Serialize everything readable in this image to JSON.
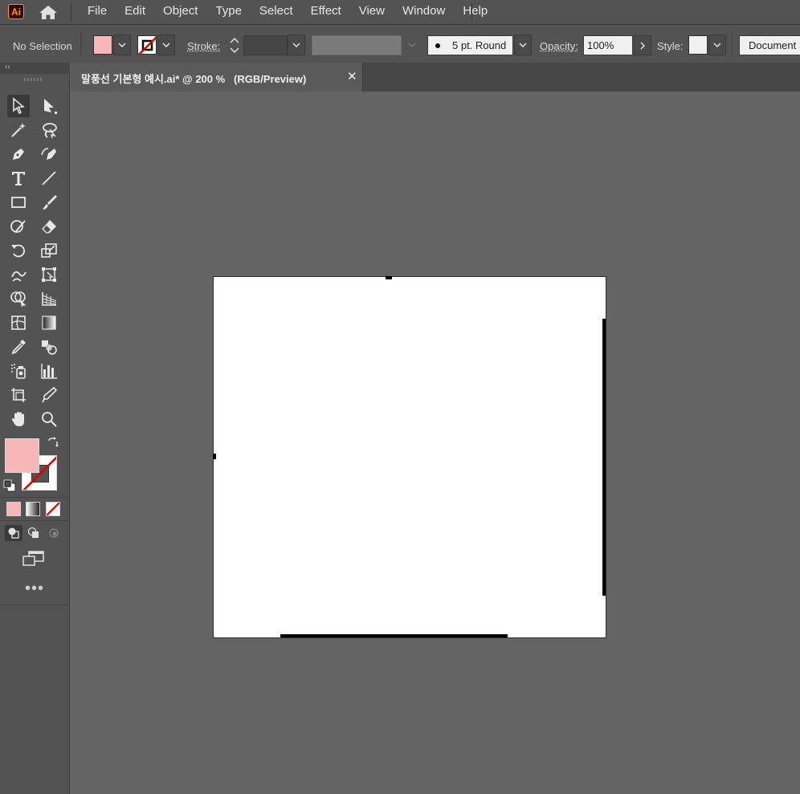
{
  "app": {
    "logo_text": "Ai",
    "brand_color": "#ff9a00"
  },
  "menu": {
    "items": [
      "File",
      "Edit",
      "Object",
      "Type",
      "Select",
      "Effect",
      "View",
      "Window",
      "Help"
    ]
  },
  "controlbar": {
    "selection_status": "No Selection",
    "fill_color": "#f7b6b8",
    "stroke_color": "none",
    "stroke_label": "Stroke:",
    "stroke_weight": "",
    "brush_label": "5 pt. Round",
    "opacity_label": "Opacity:",
    "opacity_value": "100%",
    "style_label": "Style:",
    "document_setup_label": "Document Setup"
  },
  "document_tab": {
    "title": "말풍선 기본형 예시.ai* @ 200 %   (RGB/Preview)",
    "close_symbol": "✕"
  },
  "toolbar": {
    "collapse_symbol": "‹‹",
    "more_tools_symbol": "•••",
    "tools": [
      "selection-tool",
      "direct-selection-tool",
      "magic-wand-tool",
      "lasso-tool",
      "pen-tool",
      "curvature-tool",
      "type-tool",
      "line-segment-tool",
      "rectangle-tool",
      "paintbrush-tool",
      "shaper-tool",
      "eraser-tool",
      "rotate-tool",
      "scale-tool",
      "warp-tool",
      "free-transform-tool",
      "shape-builder-tool",
      "perspective-grid-tool",
      "mesh-tool",
      "gradient-tool",
      "eyedropper-tool",
      "blend-tool",
      "symbol-sprayer-tool",
      "column-graph-tool",
      "artboard-tool",
      "slice-tool",
      "hand-tool",
      "zoom-tool"
    ],
    "fill_color": "#f7b6b8",
    "stroke_color": "none"
  }
}
